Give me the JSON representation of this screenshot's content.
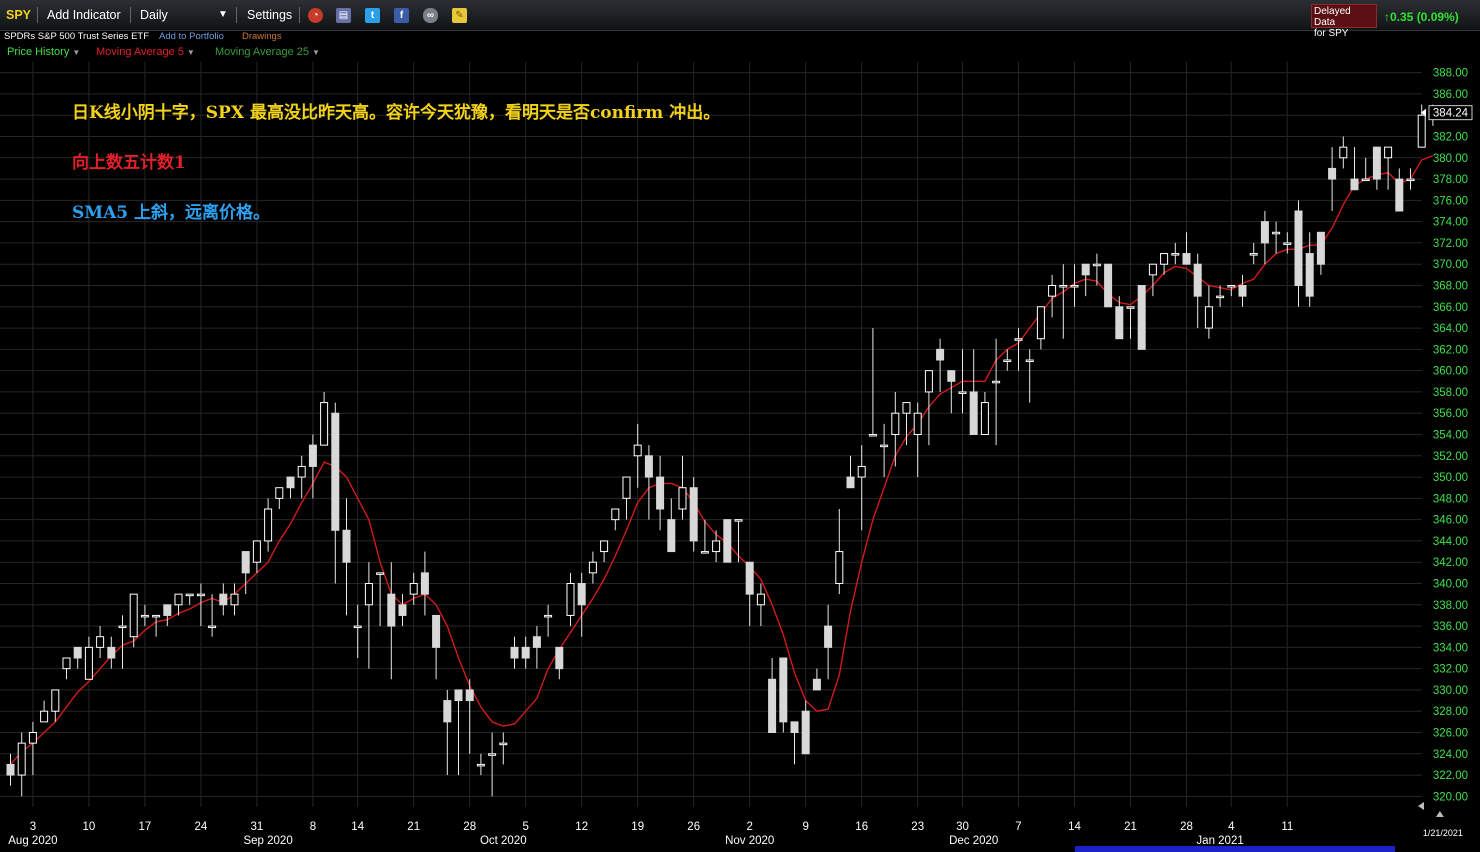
{
  "toolbar": {
    "symbol": "SPY",
    "add_indicator": "Add Indicator",
    "interval": "Daily",
    "settings": "Settings",
    "icons": [
      "alarm-clock-icon",
      "book-icon",
      "twitter-icon",
      "facebook-icon",
      "binoculars-icon",
      "note-icon"
    ],
    "delayed_line1": "Delayed Data",
    "delayed_line2": "for SPY",
    "change": "0.35 (0.09%)"
  },
  "subbar": {
    "name": "SPDRs S&P 500 Trust Series ETF",
    "add_portfolio": "Add to Portfolio",
    "drawings": "Drawings"
  },
  "legend": {
    "price_history": "Price History",
    "ma5": "Moving Average 5",
    "ma25": "Moving Average 25"
  },
  "colors": {
    "up": "#000000",
    "up_stroke": "#ffffff",
    "down": "#d8d8d8",
    "sma": "#d21a1a",
    "axis_text": "#3fe04a",
    "note1": "#f3d21a",
    "note2": "#e0202a",
    "note3": "#2ea0f0"
  },
  "annotations": [
    "日K线小阴十字，SPX 最高没比昨天高。容许今天犹豫，看明天是否confirm 冲出。",
    "向上数五计数1",
    "SMA5 上斜，远离价格。"
  ],
  "chart_data": {
    "type": "candlestick",
    "ylim": [
      319,
      389
    ],
    "y_ticks": [
      320,
      322,
      324,
      326,
      328,
      330,
      332,
      334,
      336,
      338,
      340,
      342,
      344,
      346,
      348,
      350,
      352,
      354,
      356,
      358,
      360,
      362,
      364,
      366,
      368,
      370,
      372,
      374,
      376,
      378,
      380,
      382,
      384,
      386,
      388
    ],
    "last_price_label": "384.24",
    "last_price": 384.24,
    "x_tick_labels": [
      "3",
      "10",
      "17",
      "24",
      "31",
      "8",
      "14",
      "21",
      "28",
      "5",
      "12",
      "19",
      "26",
      "2",
      "9",
      "16",
      "23",
      "30",
      "7",
      "14",
      "21",
      "28",
      "4",
      "11"
    ],
    "x_tick_index": [
      2,
      7,
      12,
      17,
      22,
      27,
      31,
      36,
      41,
      46,
      51,
      56,
      61,
      66,
      71,
      76,
      81,
      85,
      90,
      95,
      100,
      105,
      109,
      114
    ],
    "month_labels": [
      {
        "label": "Aug 2020",
        "index": 2
      },
      {
        "label": "Sep 2020",
        "index": 23
      },
      {
        "label": "Oct 2020",
        "index": 44
      },
      {
        "label": "Nov 2020",
        "index": 66
      },
      {
        "label": "Dec 2020",
        "index": 86
      },
      {
        "label": "Jan 2021",
        "index": 108
      }
    ],
    "date_label": "1/21/2021",
    "series": [
      {
        "name": "Price History",
        "ohlc": [
          [
            323,
            324,
            321,
            322
          ],
          [
            322,
            326,
            320,
            325
          ],
          [
            325,
            327,
            322,
            326
          ],
          [
            327,
            329,
            327,
            328
          ],
          [
            328,
            330,
            327,
            330
          ],
          [
            332,
            333,
            331,
            333
          ],
          [
            334,
            334,
            332,
            333
          ],
          [
            331,
            335,
            331,
            334
          ],
          [
            334,
            336,
            333,
            335
          ],
          [
            334,
            335,
            332,
            333
          ],
          [
            336,
            337,
            332,
            336
          ],
          [
            335,
            339,
            334,
            339
          ],
          [
            337,
            338,
            336,
            337
          ],
          [
            337,
            337,
            335,
            337
          ],
          [
            338,
            338,
            336,
            337
          ],
          [
            338,
            339,
            337,
            339
          ],
          [
            339,
            339,
            338,
            339
          ],
          [
            339,
            340,
            336,
            339
          ],
          [
            336,
            339,
            335,
            336
          ],
          [
            339,
            340,
            337,
            338
          ],
          [
            338,
            340,
            337,
            339
          ],
          [
            343,
            343,
            339,
            341
          ],
          [
            342,
            344,
            341,
            344
          ],
          [
            344,
            348,
            343,
            347
          ],
          [
            348,
            348,
            347,
            349
          ],
          [
            350,
            350,
            348,
            349
          ],
          [
            350,
            352,
            348,
            351
          ],
          [
            353,
            354,
            348,
            351
          ],
          [
            353,
            358,
            353,
            357
          ],
          [
            356,
            357,
            340,
            345
          ],
          [
            345,
            348,
            337,
            342
          ],
          [
            336,
            338,
            333,
            336
          ],
          [
            338,
            342,
            332,
            340
          ],
          [
            341,
            341,
            336,
            341
          ],
          [
            339,
            342,
            331,
            336
          ],
          [
            338,
            339,
            336,
            337
          ],
          [
            339,
            341,
            338,
            340
          ],
          [
            341,
            343,
            337,
            339
          ],
          [
            337,
            337,
            331,
            334
          ],
          [
            329,
            330,
            322,
            327
          ],
          [
            330,
            330,
            322,
            329
          ],
          [
            330,
            331,
            324,
            329
          ],
          [
            323,
            324,
            322,
            323
          ],
          [
            324,
            326,
            320,
            324
          ],
          [
            325,
            326,
            323,
            325
          ],
          [
            334,
            335,
            332,
            333
          ],
          [
            334,
            335,
            332,
            333
          ],
          [
            335,
            336,
            332,
            334
          ],
          [
            337,
            338,
            335,
            337
          ],
          [
            334,
            334,
            331,
            332
          ],
          [
            337,
            341,
            336,
            340
          ],
          [
            340,
            341,
            335,
            338
          ],
          [
            341,
            343,
            340,
            342
          ],
          [
            343,
            344,
            342,
            344
          ],
          [
            346,
            347,
            345,
            347
          ],
          [
            348,
            349,
            346,
            350
          ],
          [
            352,
            355,
            349,
            353
          ],
          [
            352,
            353,
            346,
            350
          ],
          [
            350,
            352,
            345,
            347
          ],
          [
            346,
            348,
            343,
            343
          ],
          [
            347,
            352,
            346,
            349
          ],
          [
            349,
            350,
            343,
            344
          ],
          [
            343,
            346,
            343,
            343
          ],
          [
            343,
            345,
            342,
            344
          ],
          [
            346,
            346,
            342,
            342
          ],
          [
            346,
            346,
            342,
            346
          ],
          [
            342,
            342,
            336,
            339
          ],
          [
            338,
            340,
            336,
            339
          ],
          [
            331,
            333,
            327,
            326
          ],
          [
            333,
            333,
            326,
            327
          ],
          [
            327,
            327,
            323,
            326
          ],
          [
            328,
            329,
            324,
            324
          ],
          [
            331,
            332,
            331,
            330
          ],
          [
            336,
            338,
            331,
            334
          ],
          [
            340,
            347,
            339,
            343
          ],
          [
            350,
            352,
            349,
            349
          ],
          [
            350,
            353,
            345,
            351
          ],
          [
            354,
            364,
            354,
            354
          ],
          [
            353,
            355,
            350,
            353
          ],
          [
            354,
            358,
            351,
            356
          ],
          [
            356,
            357,
            353,
            357
          ],
          [
            354,
            357,
            350,
            356
          ],
          [
            358,
            360,
            353,
            360
          ],
          [
            362,
            363,
            358,
            361
          ],
          [
            360,
            360,
            356,
            359
          ],
          [
            358,
            362,
            356,
            358
          ],
          [
            358,
            362,
            354,
            354
          ],
          [
            354,
            358,
            355,
            357
          ],
          [
            359,
            363,
            353,
            359
          ],
          [
            361,
            362,
            360,
            361
          ],
          [
            363,
            364,
            360,
            363
          ],
          [
            361,
            362,
            357,
            361
          ],
          [
            363,
            365,
            362,
            366
          ],
          [
            367,
            369,
            365,
            368
          ],
          [
            368,
            370,
            363,
            368
          ],
          [
            368,
            370,
            366,
            368
          ],
          [
            370,
            370,
            367,
            369
          ],
          [
            370,
            371,
            368,
            370
          ],
          [
            370,
            370,
            367,
            366
          ],
          [
            366,
            367,
            363,
            363
          ],
          [
            366,
            366,
            363,
            366
          ],
          [
            368,
            368,
            362,
            362
          ],
          [
            369,
            370,
            367,
            370
          ],
          [
            370,
            371,
            369,
            371
          ],
          [
            371,
            372,
            370,
            371
          ],
          [
            371,
            373,
            370,
            370
          ],
          [
            370,
            371,
            364,
            367
          ],
          [
            364,
            368,
            363,
            366
          ],
          [
            367,
            368,
            366,
            367
          ],
          [
            368,
            368,
            367,
            368
          ],
          [
            368,
            369,
            366,
            367
          ],
          [
            371,
            372,
            370,
            371
          ],
          [
            374,
            375,
            370,
            372
          ],
          [
            373,
            374,
            371,
            373
          ],
          [
            372,
            373,
            371,
            372
          ],
          [
            375,
            376,
            366,
            368
          ],
          [
            371,
            373,
            366,
            367
          ],
          [
            373,
            373,
            369,
            370
          ],
          [
            379,
            381,
            375,
            378
          ],
          [
            380,
            382,
            379,
            381
          ],
          [
            378,
            381,
            377,
            377
          ],
          [
            378,
            380,
            378,
            378
          ],
          [
            381,
            381,
            377,
            378
          ],
          [
            380,
            381,
            377,
            381
          ],
          [
            378,
            379,
            375,
            375
          ],
          [
            378,
            379,
            377,
            378
          ],
          [
            381,
            385,
            381,
            384
          ],
          [
            384,
            385,
            383,
            384
          ]
        ]
      },
      {
        "name": "Moving Average 5",
        "values": [
          323,
          324.2,
          325,
          326,
          327,
          328.4,
          329.8,
          330.8,
          332,
          333.2,
          334.2,
          334.6,
          335.6,
          336.4,
          336.6,
          337.2,
          337.6,
          338.2,
          338.6,
          338.2,
          339,
          340,
          341,
          342,
          344,
          345.6,
          347.6,
          349.4,
          351.4,
          351,
          350,
          348,
          346,
          342,
          339,
          338,
          338.6,
          339,
          338,
          336,
          333,
          330.4,
          328.4,
          327,
          326.6,
          326.8,
          328,
          329.2,
          332,
          333.8,
          335.4,
          337,
          338.6,
          340.4,
          342.6,
          345,
          347.6,
          349,
          349.4,
          349.4,
          349,
          347.6,
          345.8,
          344.6,
          343.8,
          342.6,
          341.6,
          340.4,
          338,
          335.2,
          331.6,
          329,
          328,
          328.2,
          331.4,
          337.4,
          342,
          346,
          349,
          352,
          353.8,
          355,
          356.6,
          357.8,
          358.4,
          359,
          359,
          359,
          361,
          362,
          362.6,
          364,
          365.4,
          366.8,
          367.4,
          368.2,
          368.6,
          368.4,
          367.2,
          366.4,
          366.2,
          367,
          368,
          369.2,
          369.8,
          369.6,
          368.8,
          368,
          367.8,
          367.6,
          368.2,
          368.6,
          370,
          371,
          371.4,
          371.4,
          371.8,
          371.8,
          373.4,
          375.6,
          377.4,
          378,
          378.4,
          378.6,
          377.6,
          378,
          379.8,
          380.2
        ]
      }
    ]
  }
}
